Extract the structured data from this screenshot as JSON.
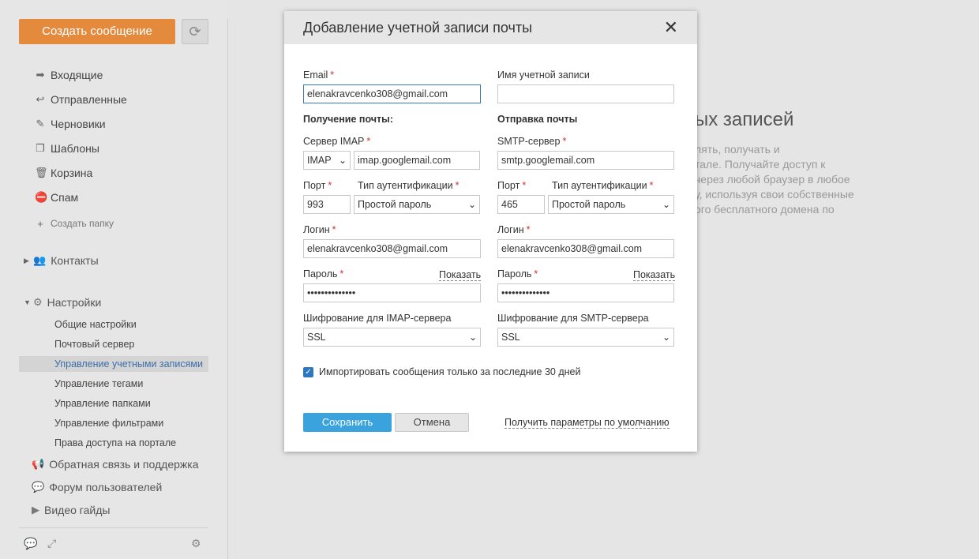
{
  "sidebar": {
    "compose_label": "Создать сообщение",
    "folders": [
      {
        "label": "Входящие",
        "icon": "inbox-arrow-icon"
      },
      {
        "label": "Отправленные",
        "icon": "reply-icon"
      },
      {
        "label": "Черновики",
        "icon": "edit-icon"
      },
      {
        "label": "Шаблоны",
        "icon": "copy-icon"
      },
      {
        "label": "Корзина",
        "icon": "trash-icon"
      },
      {
        "label": "Спам",
        "icon": "spam-icon"
      }
    ],
    "create_folder": "Создать папку",
    "contacts": "Контакты",
    "settings": "Настройки",
    "settings_items": [
      "Общие настройки",
      "Почтовый сервер",
      "Управление учетными записями",
      "Управление тегами",
      "Управление папками",
      "Управление фильтрами",
      "Права доступа на портале"
    ],
    "feedback": "Обратная связь и поддержка",
    "forum": "Форум пользователей",
    "videos": "Видео гайды"
  },
  "background": {
    "title": "ых записей",
    "text_lines": [
      "лять, получать и",
      "тале. Получайте доступ к",
      "через любой браузер в любое",
      "у, используя свои собственные",
      "ого бесплатного домена по"
    ]
  },
  "dialog": {
    "title": "Добавление учетной записи почты",
    "email_label": "Email",
    "email_value": "elenakravcenko308@gmail.com",
    "account_name_label": "Имя учетной записи",
    "account_name_value": "",
    "incoming_heading": "Получение почты:",
    "outgoing_heading": "Отправка почты",
    "imap_server_label": "Сервер IMAP",
    "protocol_value": "IMAP",
    "imap_server_value": "imap.googlemail.com",
    "smtp_server_label": "SMTP-сервер",
    "smtp_server_value": "smtp.googlemail.com",
    "port_label": "Порт",
    "auth_label": "Тип аутентификации",
    "imap_port_value": "993",
    "smtp_port_value": "465",
    "auth_value": "Простой пароль",
    "login_label": "Логин",
    "imap_login_value": "elenakravcenko308@gmail.com",
    "smtp_login_value": "elenakravcenko308@gmail.com",
    "password_label": "Пароль",
    "show_label": "Показать",
    "password_mask": "••••••••••••••",
    "imap_encryption_label": "Шифрование для IMAP-сервера",
    "smtp_encryption_label": "Шифрование для SMTP-сервера",
    "encryption_value": "SSL",
    "import_checkbox_label": "Импортировать сообщения только за последние 30 дней",
    "save_label": "Сохранить",
    "cancel_label": "Отмена",
    "defaults_link": "Получить параметры по умолчанию"
  }
}
